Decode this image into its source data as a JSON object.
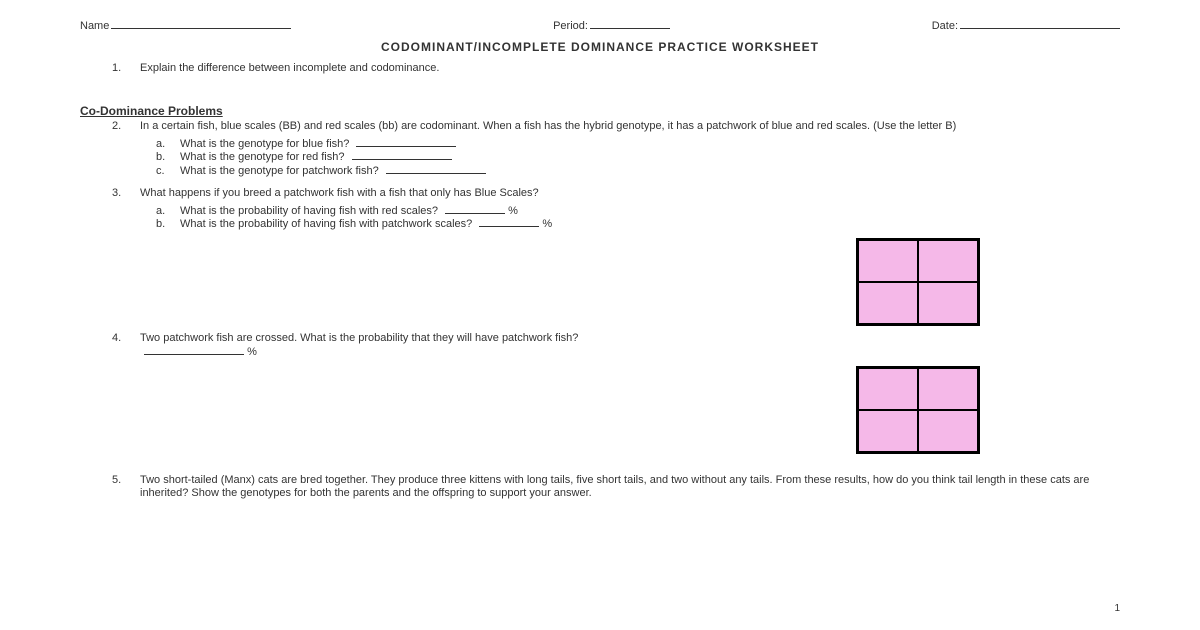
{
  "header": {
    "name_label": "Name",
    "period_label": "Period:",
    "date_label": "Date:"
  },
  "title": "CODOMINANT/INCOMPLETE DOMINANCE PRACTICE WORKSHEET",
  "q1": {
    "num": "1.",
    "text": "Explain the difference between incomplete and codominance."
  },
  "section_heading": "Co-Dominance Problems",
  "q2": {
    "num": "2.",
    "text": "In a certain fish, blue scales (BB) and red scales (bb) are codominant. When a fish has the hybrid genotype, it has a patchwork of blue and red scales. (Use the letter B)",
    "a": {
      "letter": "a.",
      "text": "What is the genotype for blue fish?"
    },
    "b": {
      "letter": "b.",
      "text": "What is the genotype for red fish?"
    },
    "c": {
      "letter": "c.",
      "text": "What is the genotype for patchwork fish?"
    }
  },
  "q3": {
    "num": "3.",
    "text": "What happens if you breed a patchwork fish with a fish that only has Blue Scales?",
    "a": {
      "letter": "a.",
      "text": "What is the probability of having fish with red scales?",
      "unit": "%"
    },
    "b": {
      "letter": "b.",
      "text": "What is the probability of having fish with patchwork scales?",
      "unit": "%"
    }
  },
  "q4": {
    "num": "4.",
    "text": "Two patchwork fish are crossed.  What is the probability that they will have patchwork fish?",
    "unit": "%"
  },
  "q5": {
    "num": "5.",
    "text": "Two short-tailed (Manx) cats are bred together. They produce three kittens with long tails, five short tails, and two without any tails. From these results, how do you think tail length in these cats are inherited? Show the genotypes for both the parents and the offspring to support your answer."
  },
  "page_number": "1"
}
